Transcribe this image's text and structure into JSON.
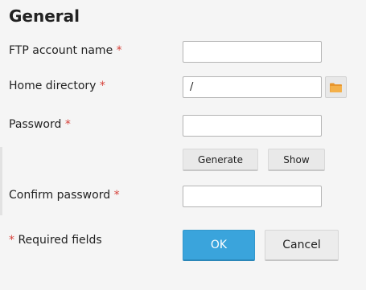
{
  "section": {
    "title": "General"
  },
  "required_marker": "*",
  "fields": {
    "ftp_account_name": {
      "label": "FTP account name",
      "value": ""
    },
    "home_directory": {
      "label": "Home directory",
      "value": "/"
    },
    "password": {
      "label": "Password",
      "value": ""
    },
    "confirm_password": {
      "label": "Confirm password",
      "value": ""
    }
  },
  "password_actions": {
    "generate_label": "Generate",
    "show_label": "Show"
  },
  "footer": {
    "required_note": "Required fields",
    "ok_label": "OK",
    "cancel_label": "Cancel"
  },
  "icons": {
    "browse": "folder-icon"
  },
  "colors": {
    "primary": "#3aa4dc",
    "required": "#d6413a",
    "folder": "#f0a640"
  }
}
